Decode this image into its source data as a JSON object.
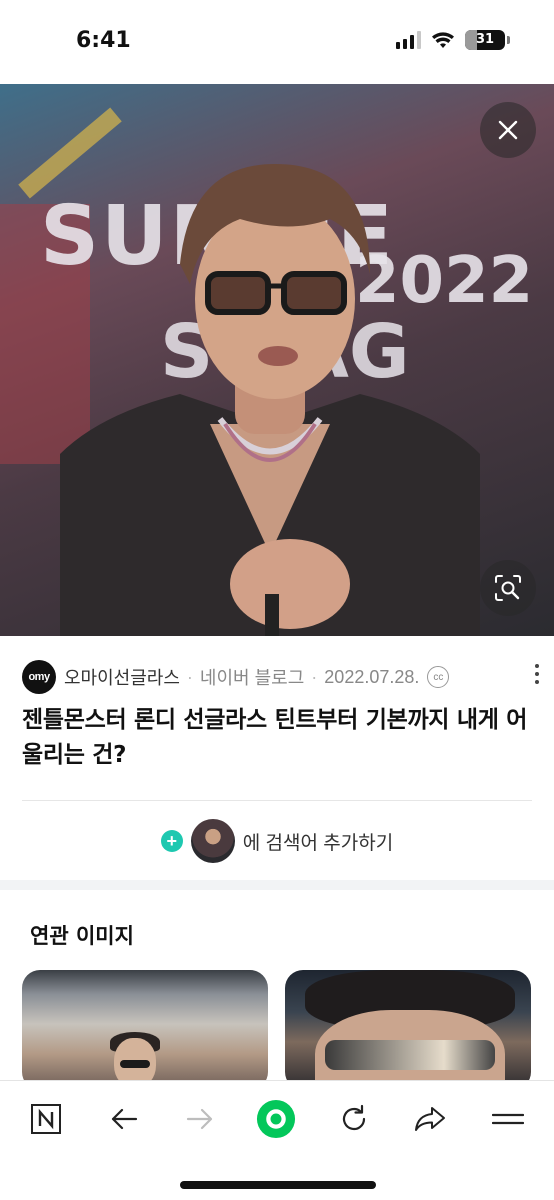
{
  "status_bar": {
    "time": "6:41",
    "battery_level": "31",
    "battery_fraction": 0.31,
    "icons": [
      "signal-icon",
      "wifi-icon",
      "battery-icon"
    ]
  },
  "hero_image": {
    "overlay_icons": [
      "close-icon",
      "lens-search-icon"
    ],
    "bg_text_line1": "SUMME",
    "bg_text_line2": "2022",
    "bg_text_line3": "SWAG"
  },
  "source": {
    "logo_text": "omy",
    "name": "오마이선글라스",
    "platform": "네이버 블로그",
    "date": "2022.07.28.",
    "license_icon": "cc-icon",
    "more_icon": "more-vertical-icon"
  },
  "title": "젠틀몬스터 론디 선글라스 틴트부터 기본까지 내게 어울리는 건?",
  "add_search": {
    "label": "에 검색어 추가하기",
    "plus_icon": "plus-icon"
  },
  "related": {
    "heading": "연관 이미지"
  },
  "bottom_nav": {
    "items": [
      "naver-home-icon",
      "back-arrow-icon",
      "forward-arrow-icon",
      "green-dot-icon",
      "refresh-icon",
      "share-icon",
      "menu-icon"
    ]
  },
  "colors": {
    "accent_green": "#03c75a",
    "plus_teal": "#1ec8b0"
  }
}
